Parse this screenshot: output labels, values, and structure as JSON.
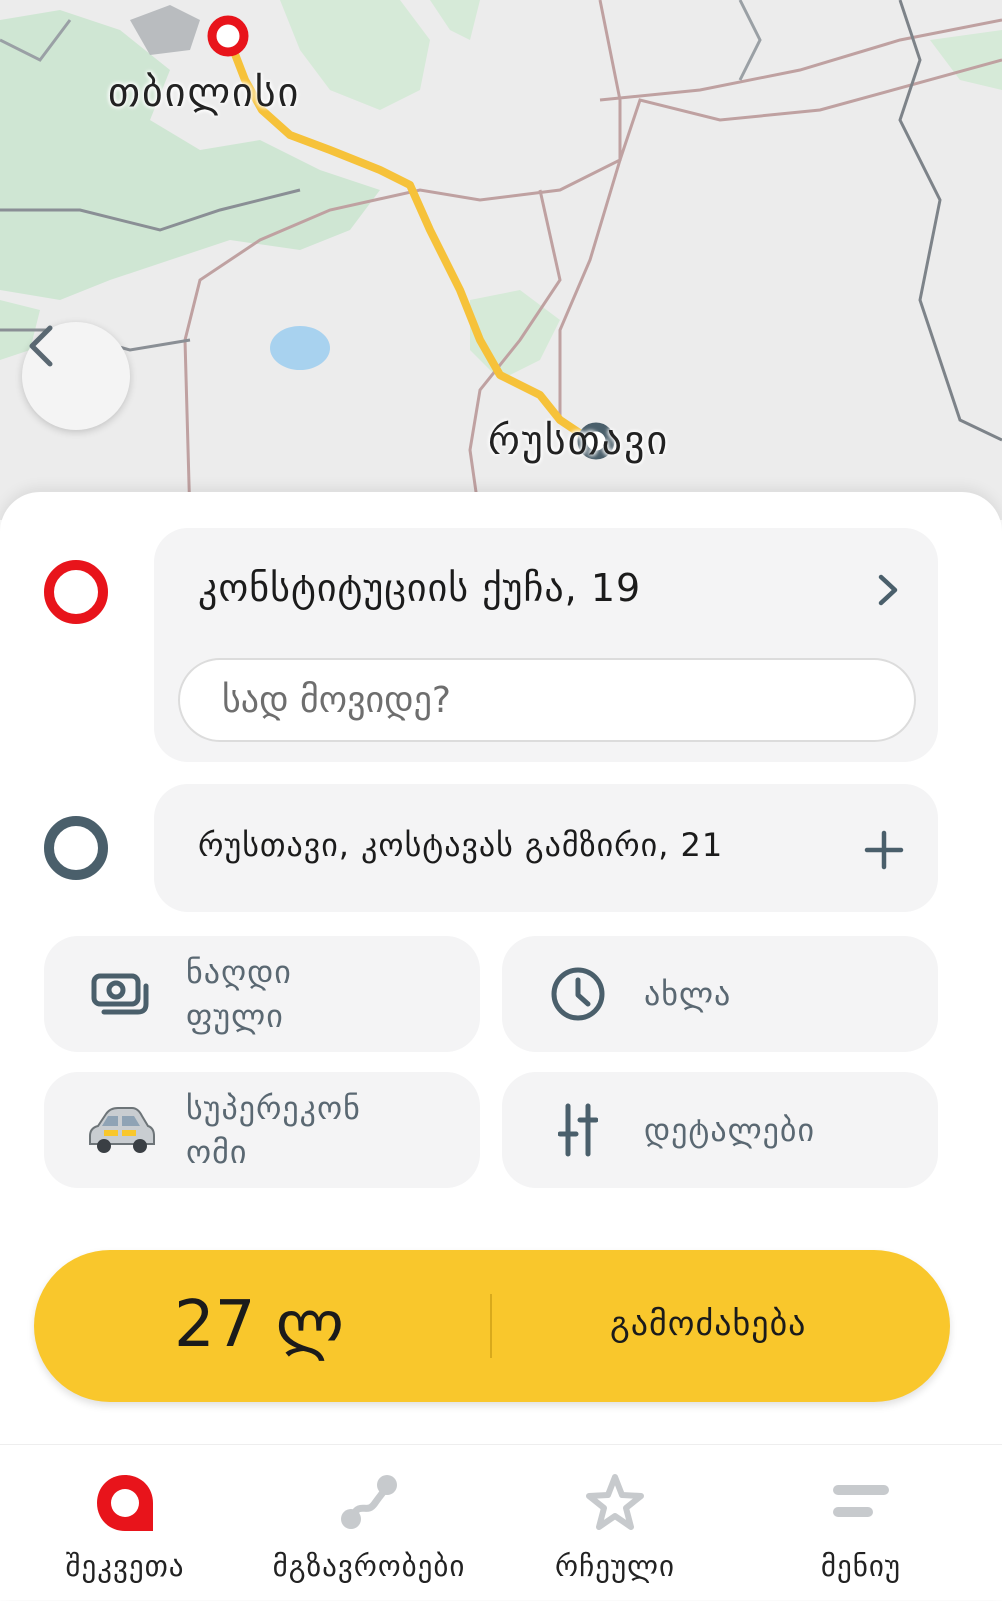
{
  "map": {
    "city_top": "თბილისი",
    "city_bottom": "რუსთავი"
  },
  "route": {
    "from_address": "კონსტიტუციის ქუჩა, 19",
    "destination_placeholder": "სად მოვიდე?",
    "to_address": "რუსთავი, კოსტავას გამზირი, 21"
  },
  "options": {
    "payment": [
      "ნაღდი",
      "ფული"
    ],
    "time": "ახლა",
    "tariff": [
      "სუპერეკონ",
      "ომი"
    ],
    "details": "დეტალები"
  },
  "order": {
    "price": "27 ლ",
    "button_label": "გამოძახება"
  },
  "nav": [
    {
      "label": "შეკვეთა",
      "icon": "order-pin-icon",
      "active": true
    },
    {
      "label": "მგზავრობები",
      "icon": "trips-icon",
      "active": false
    },
    {
      "label": "რჩეული",
      "icon": "star-icon",
      "active": false
    },
    {
      "label": "მენიუ",
      "icon": "menu-icon",
      "active": false
    }
  ],
  "colors": {
    "accent_yellow": "#f9c72c",
    "origin_red": "#e8141b",
    "destination_slate": "#4a5f6b",
    "route_line": "#f6c23a"
  }
}
